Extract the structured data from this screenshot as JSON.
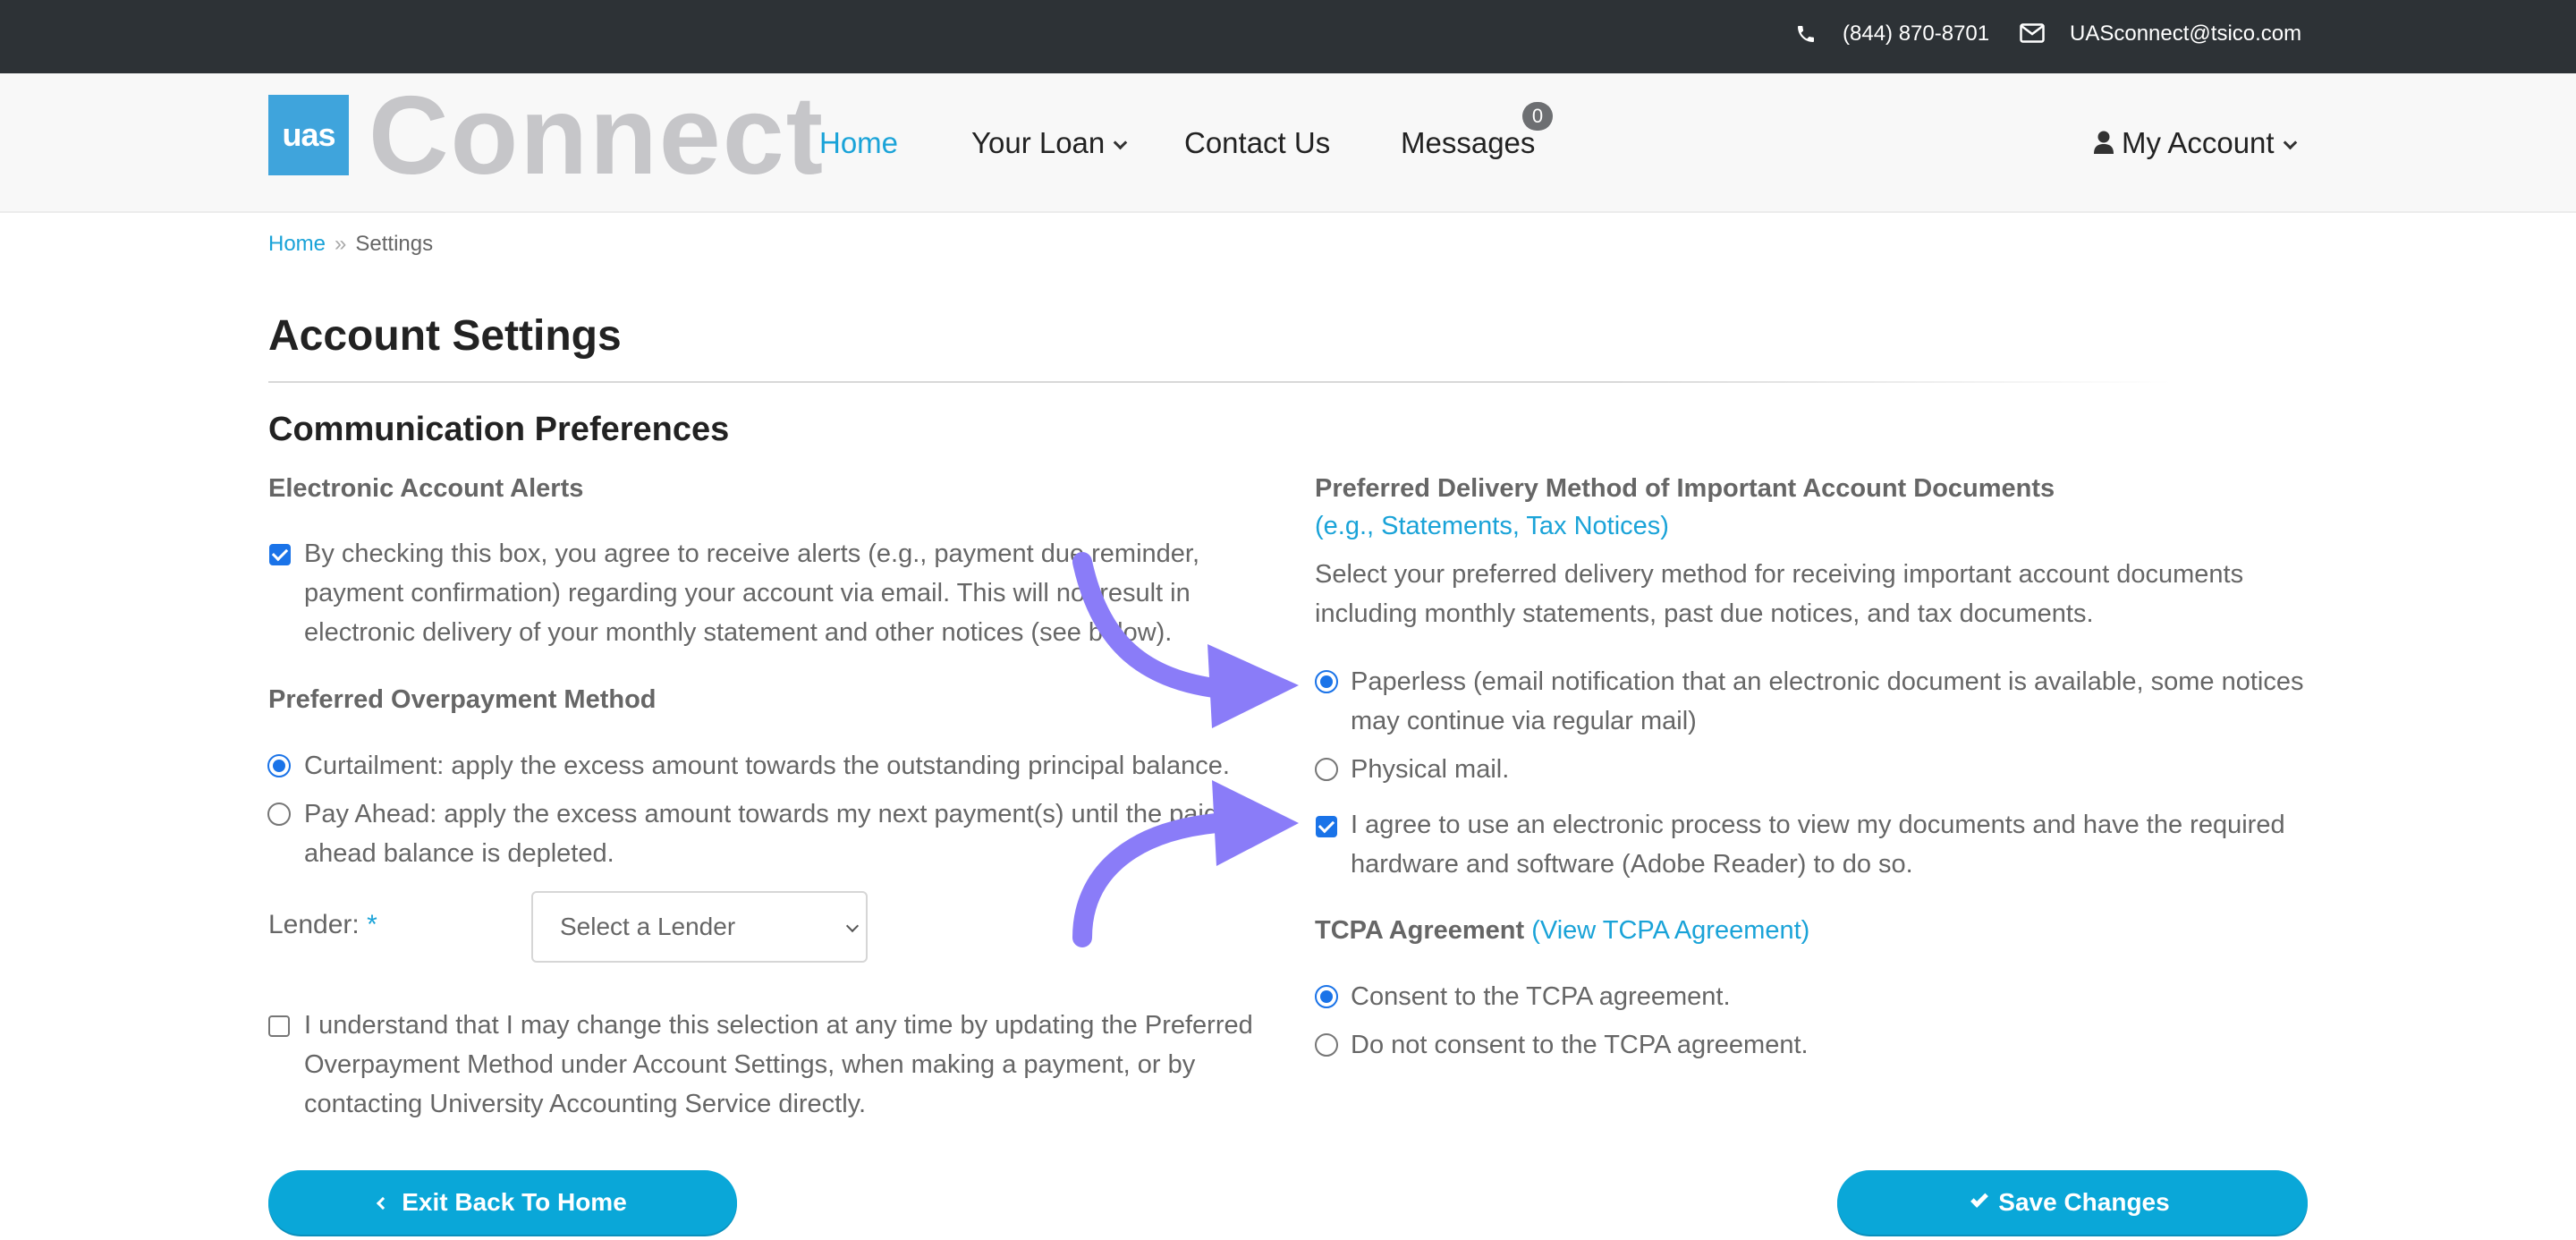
{
  "topbar": {
    "phone": "(844) 870-8701",
    "email": "UASconnect@tsico.com"
  },
  "logo": {
    "box": "uas",
    "word": "Connect"
  },
  "nav": {
    "home": "Home",
    "your_loan": "Your Loan",
    "contact": "Contact Us",
    "messages": "Messages",
    "messages_count": "0",
    "my_account": "My Account"
  },
  "breadcrumb": {
    "home": "Home",
    "separator": "»",
    "current": "Settings"
  },
  "page_title": "Account Settings",
  "section_title": "Communication Preferences",
  "alerts": {
    "heading": "Electronic Account Alerts",
    "checkbox_checked": true,
    "text": "By checking this box, you agree to receive alerts (e.g., payment due reminder, payment confirmation) regarding your account via email. This will not result in electronic delivery of your monthly statement and other notices (see below)."
  },
  "overpayment": {
    "heading": "Preferred Overpayment Method",
    "options": [
      {
        "label": "Curtailment: apply the excess amount towards the outstanding principal balance.",
        "selected": true
      },
      {
        "label": "Pay Ahead: apply the excess amount towards my next payment(s) until the paid ahead balance is depleted.",
        "selected": false
      }
    ],
    "lender_label": "Lender:",
    "lender_required": "*",
    "lender_placeholder": "Select a Lender",
    "acknowledge_checked": false,
    "acknowledge_text": "I understand that I may change this selection at any time by updating the Preferred Overpayment Method under Account Settings, when making a payment, or by contacting University Accounting Service directly."
  },
  "delivery": {
    "heading": "Preferred Delivery Method of Important Account Documents",
    "examples_link": "(e.g., Statements, Tax Notices)",
    "description": "Select your preferred delivery method for receiving important account documents including monthly statements, past due notices, and tax documents.",
    "options": [
      {
        "label": "Paperless (email notification that an electronic document is available, some notices may continue via regular mail)",
        "selected": true
      },
      {
        "label": "Physical mail.",
        "selected": false
      }
    ],
    "agree_checked": true,
    "agree_text": "I agree to use an electronic process to view my documents and have the required hardware and software (Adobe Reader) to do so."
  },
  "tcpa": {
    "heading": "TCPA Agreement",
    "link": "(View TCPA Agreement)",
    "options": [
      {
        "label": "Consent to the TCPA agreement.",
        "selected": true
      },
      {
        "label": "Do not consent to the TCPA agreement.",
        "selected": false
      }
    ]
  },
  "buttons": {
    "exit": "Exit Back To Home",
    "save": "Save Changes"
  },
  "colors": {
    "accent": "#1aa3d8",
    "button": "#0aa7d8",
    "topbar": "#2d3236",
    "annotation_arrow": "#8a7cf8"
  },
  "icons": [
    "phone-icon",
    "mail-icon",
    "chevron-down-icon",
    "user-icon",
    "chevron-left-icon",
    "checkmark-icon",
    "annotation-arrow"
  ]
}
